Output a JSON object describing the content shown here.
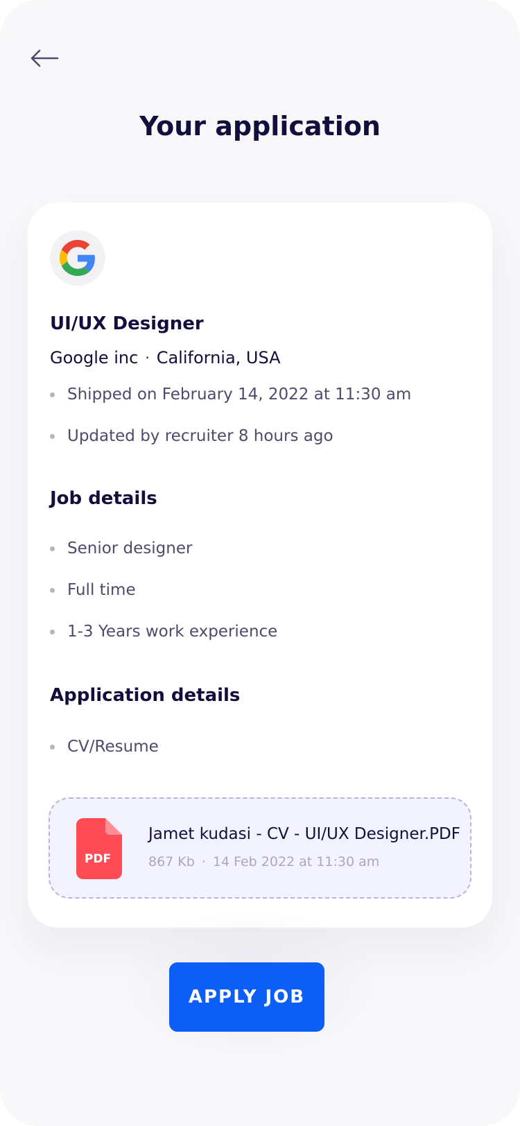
{
  "header": {
    "title": "Your application",
    "back_icon": "arrow-left-icon"
  },
  "job": {
    "logo_icon": "google-logo-icon",
    "title": "UI/UX Designer",
    "company": "Google inc",
    "separator": "·",
    "location": "California, USA",
    "status_items": [
      "Shipped on February 14, 2022 at 11:30 am",
      "Updated by recruiter 8 hours ago"
    ]
  },
  "job_details": {
    "heading": "Job details",
    "items": [
      "Senior designer",
      "Full time",
      "1-3 Years work experience"
    ]
  },
  "application_details": {
    "heading": "Application details",
    "items": [
      "CV/Resume"
    ],
    "file": {
      "icon": "pdf-file-icon",
      "icon_label": "PDF",
      "name": "Jamet kudasi - CV - UI/UX Designer.PDF",
      "size": "867 Kb",
      "separator": "·",
      "date": "14 Feb 2022 at 11:30 am"
    }
  },
  "apply_button": {
    "label": "APPLY JOB"
  },
  "colors": {
    "accent": "#0D5EF4",
    "title": "#130F3D",
    "body": "#4E4B6C",
    "pdf": "#FF4B55",
    "file_box_bg": "#F3F2FF"
  }
}
